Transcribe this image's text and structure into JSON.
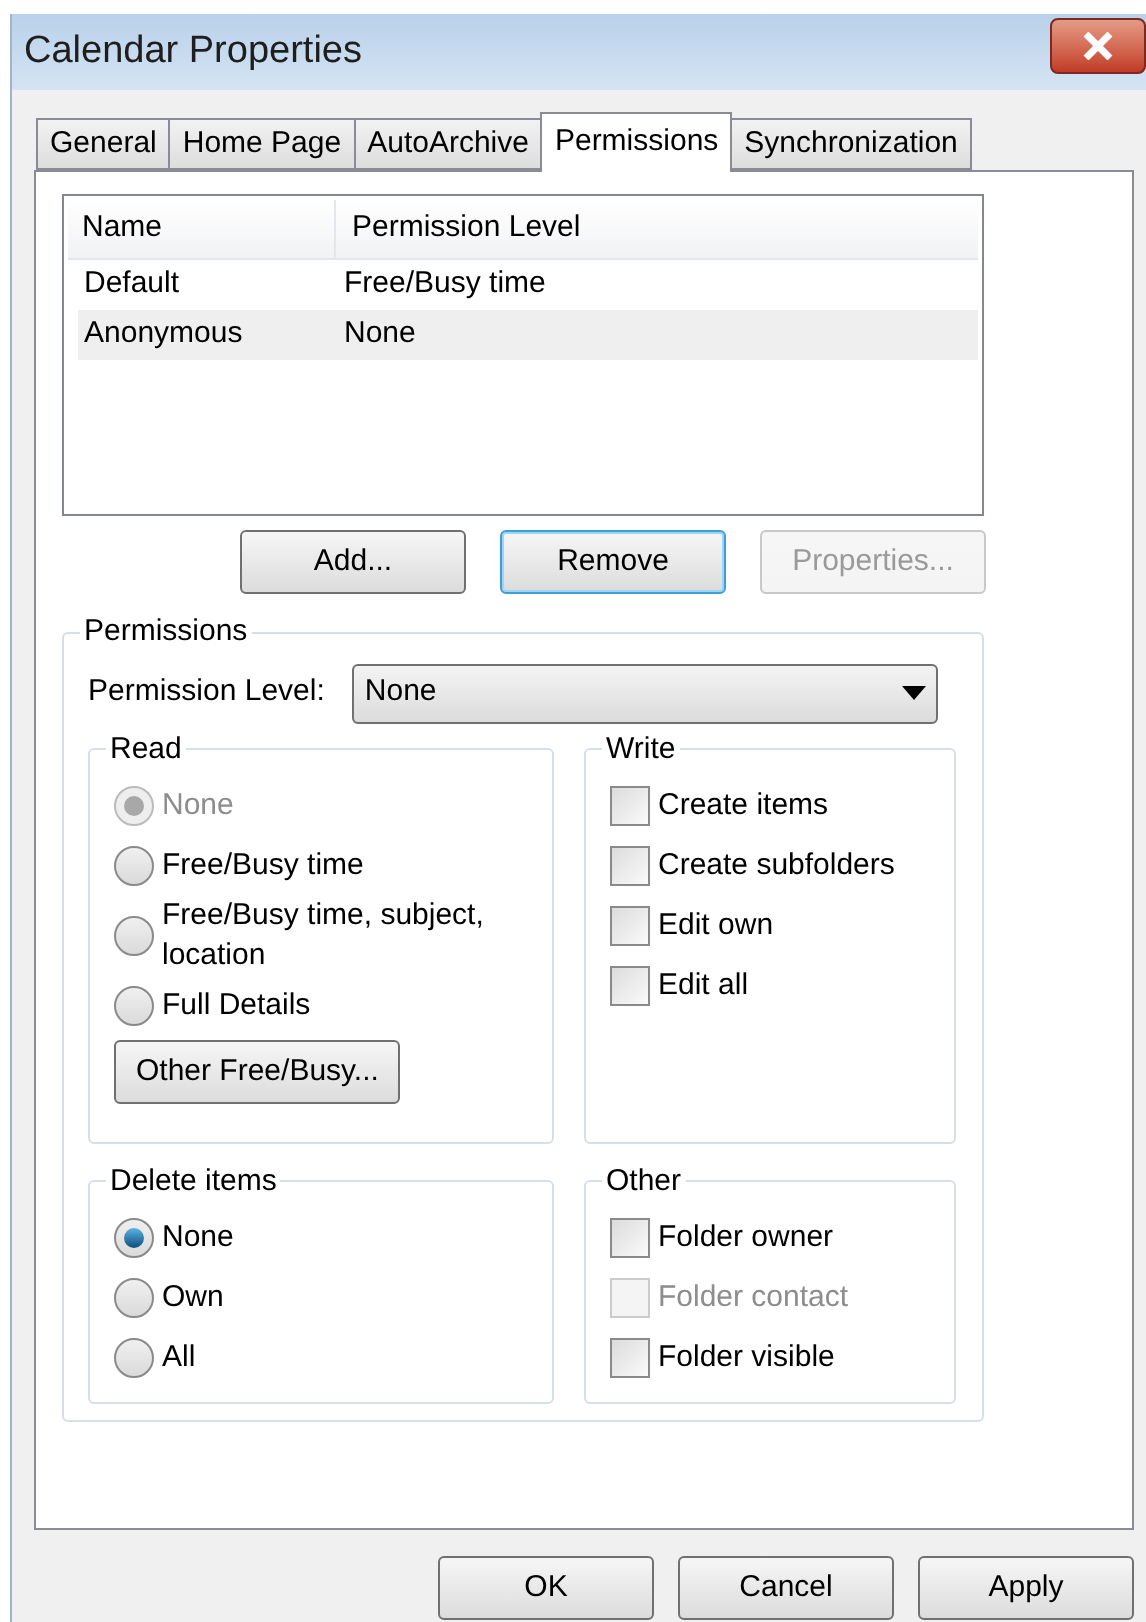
{
  "window": {
    "title": "Calendar Properties"
  },
  "tabs": [
    {
      "label": "General",
      "selected": false
    },
    {
      "label": "Home Page",
      "selected": false
    },
    {
      "label": "AutoArchive",
      "selected": false
    },
    {
      "label": "Permissions",
      "selected": true
    },
    {
      "label": "Synchronization",
      "selected": false
    }
  ],
  "table": {
    "columns": [
      "Name",
      "Permission Level"
    ],
    "rows": [
      {
        "cells": [
          "Default",
          "Free/Busy time"
        ],
        "selected": false
      },
      {
        "cells": [
          "Anonymous",
          "None"
        ],
        "selected": true
      }
    ]
  },
  "row_buttons": [
    {
      "label": "Add...",
      "disabled": false,
      "focused": false
    },
    {
      "label": "Remove",
      "disabled": false,
      "focused": true
    },
    {
      "label": "Properties...",
      "disabled": true,
      "focused": false
    }
  ],
  "permissions": {
    "title": "Permissions",
    "level_label": "Permission Level:",
    "level_value": "None",
    "read": {
      "title": "Read",
      "options": [
        {
          "label": "None",
          "selected": true,
          "disabled": true
        },
        {
          "label": "Free/Busy time",
          "selected": false,
          "disabled": false
        },
        {
          "label": "Free/Busy time, subject, location",
          "selected": false,
          "disabled": false
        },
        {
          "label": "Full Details",
          "selected": false,
          "disabled": false
        }
      ],
      "button": "Other Free/Busy..."
    },
    "write": {
      "title": "Write",
      "options": [
        {
          "label": "Create items",
          "checked": false,
          "disabled": false
        },
        {
          "label": "Create subfolders",
          "checked": false,
          "disabled": false
        },
        {
          "label": "Edit own",
          "checked": false,
          "disabled": false
        },
        {
          "label": "Edit all",
          "checked": false,
          "disabled": false
        }
      ]
    },
    "delete": {
      "title": "Delete items",
      "options": [
        {
          "label": "None",
          "selected": true,
          "disabled": false
        },
        {
          "label": "Own",
          "selected": false,
          "disabled": false
        },
        {
          "label": "All",
          "selected": false,
          "disabled": false
        }
      ]
    },
    "other": {
      "title": "Other",
      "options": [
        {
          "label": "Folder owner",
          "checked": false,
          "disabled": false
        },
        {
          "label": "Folder contact",
          "checked": false,
          "disabled": true
        },
        {
          "label": "Folder visible",
          "checked": false,
          "disabled": false
        }
      ]
    }
  },
  "buttons": [
    "OK",
    "Cancel",
    "Apply"
  ]
}
